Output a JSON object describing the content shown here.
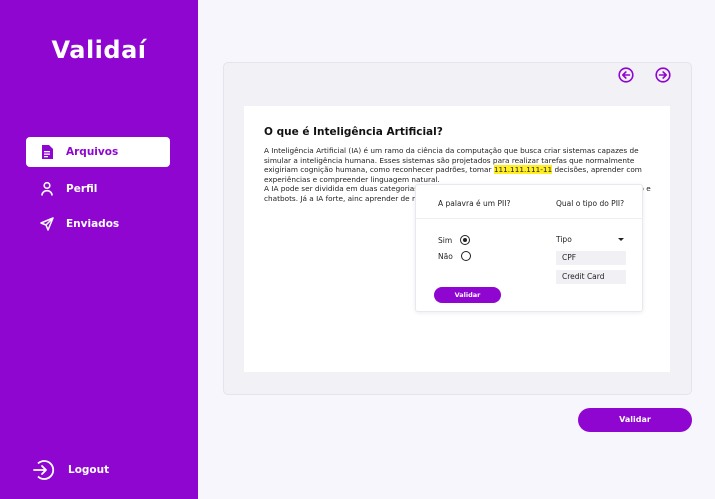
{
  "app": {
    "logo": "Validaí"
  },
  "sidebar": {
    "items": [
      {
        "label": "Arquivos",
        "icon": "document-icon",
        "active": true
      },
      {
        "label": "Perfil",
        "icon": "user-icon",
        "active": false
      },
      {
        "label": "Enviados",
        "icon": "send-icon",
        "active": false
      }
    ],
    "logout_label": "Logout"
  },
  "toolbar": {
    "prev_icon": "arrow-left-icon",
    "next_icon": "arrow-right-icon"
  },
  "document": {
    "title": "O que é Inteligência Artificial?",
    "para1_before": "A Inteligência Artificial (IA) é um ramo da ciência da computação que busca criar sistemas capazes de simular a inteligência humana. Esses sistemas são projetados para realizar tarefas que normalmente exigiriam cognição humana, como reconhecer padrões, tomar ",
    "highlight": "111.111.111-11",
    "para1_after": " decisões, aprender com experiências e compreender linguagem natural.",
    "para2": "A IA pode ser dividida em duas categorias p estreita, é programada para realizar tarefas recomendação e chatbots. Já a IA forte, ainc aprender de maneira geral, como um ser h"
  },
  "popup": {
    "question_pii": "A palavra é um PII?",
    "question_type": "Qual o tipo do PII?",
    "options": [
      {
        "label": "Sim",
        "selected": true
      },
      {
        "label": "Não",
        "selected": false
      }
    ],
    "type_select": "Tipo",
    "type_options": [
      "CPF",
      "Credit Card"
    ],
    "validate_label": "Validar"
  },
  "main": {
    "validate_label": "Validar"
  },
  "colors": {
    "accent": "#8f06d0",
    "highlight": "#ffee22"
  }
}
